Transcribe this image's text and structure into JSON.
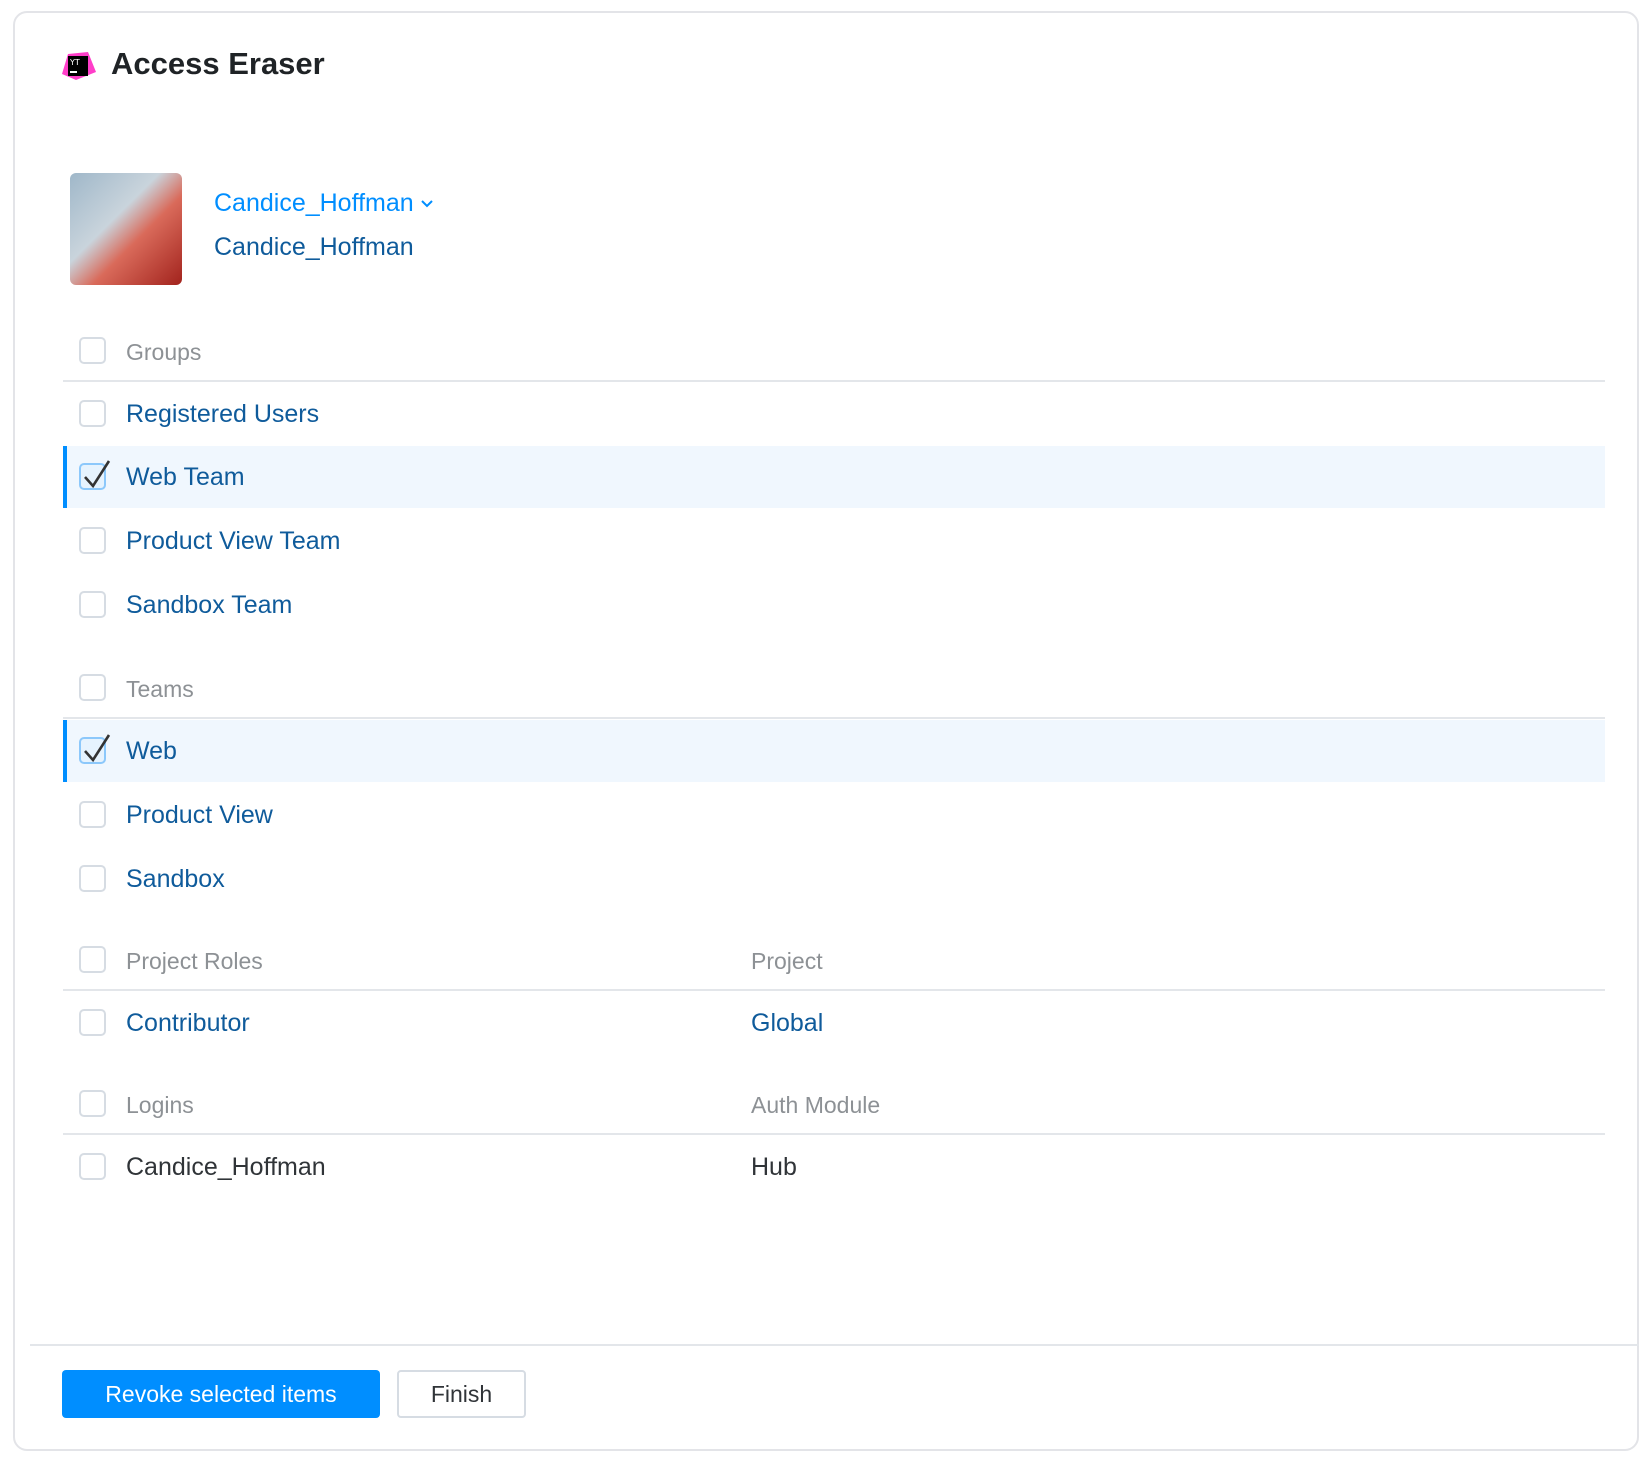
{
  "app": {
    "title": "Access Eraser",
    "logo_text": "YT"
  },
  "user": {
    "name_selector": "Candice_Hoffman",
    "login": "Candice_Hoffman"
  },
  "groups": {
    "header": "Groups",
    "items": [
      {
        "label": "Registered Users",
        "checked": false
      },
      {
        "label": "Web Team",
        "checked": true
      },
      {
        "label": "Product View Team",
        "checked": false
      },
      {
        "label": "Sandbox Team",
        "checked": false
      }
    ]
  },
  "teams": {
    "header": "Teams",
    "items": [
      {
        "label": "Web",
        "checked": true
      },
      {
        "label": "Product View",
        "checked": false
      },
      {
        "label": "Sandbox",
        "checked": false
      }
    ]
  },
  "roles": {
    "header": "Project Roles",
    "col2": "Project",
    "items": [
      {
        "label": "Contributor",
        "project": "Global"
      }
    ]
  },
  "logins": {
    "header": "Logins",
    "col2": "Auth Module",
    "items": [
      {
        "label": "Candice_Hoffman",
        "module": "Hub"
      }
    ]
  },
  "footer": {
    "revoke": "Revoke selected items",
    "finish": "Finish"
  },
  "colors": {
    "accent": "#008eff",
    "link": "#0f5b9b"
  }
}
